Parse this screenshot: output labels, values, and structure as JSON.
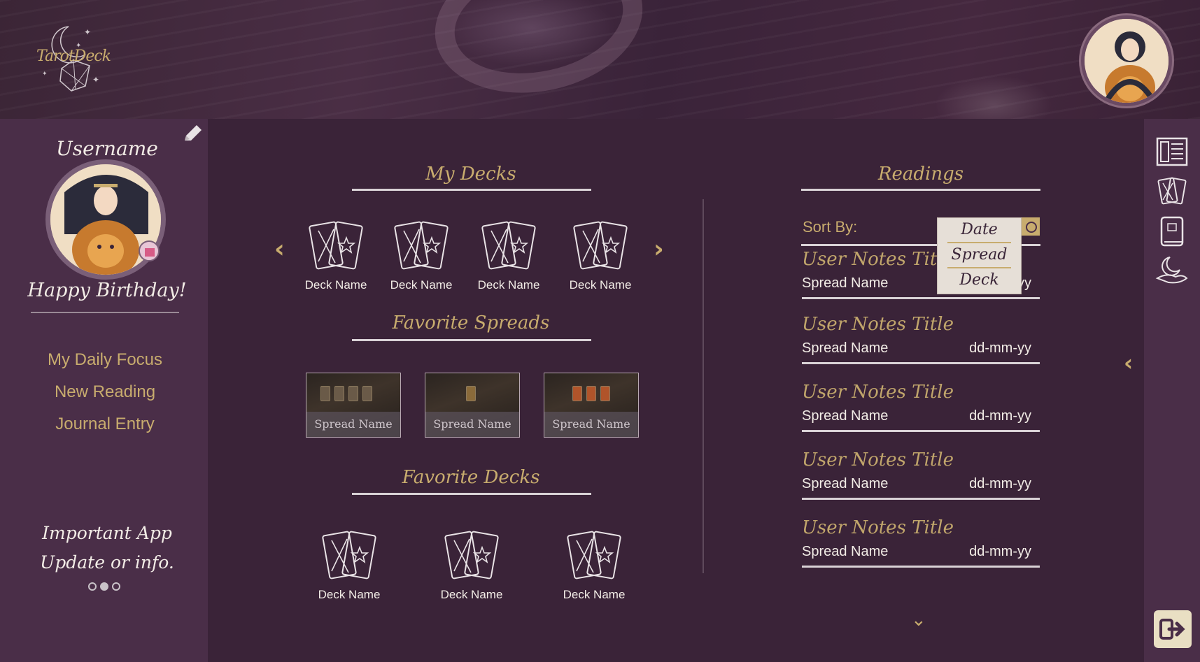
{
  "app": {
    "logo_text": "TarotDeck"
  },
  "profile": {
    "username": "Username",
    "greeting": "Happy Birthday!"
  },
  "left_nav": [
    "My Daily Focus",
    "New Reading",
    "Journal Entry"
  ],
  "info_banner": {
    "line1": "Important App",
    "line2": "Update or info."
  },
  "my_decks": {
    "title": "My Decks",
    "items": [
      "Deck Name",
      "Deck Name",
      "Deck Name",
      "Deck Name"
    ]
  },
  "favorite_spreads": {
    "title": "Favorite Spreads",
    "items": [
      "Spread Name",
      "Spread Name",
      "Spread Name"
    ]
  },
  "favorite_decks": {
    "title": "Favorite Decks",
    "items": [
      "Deck Name",
      "Deck Name",
      "Deck Name"
    ]
  },
  "readings": {
    "title": "Readings",
    "sort_label": "Sort By:",
    "sort_options": [
      "Date",
      "Spread",
      "Deck"
    ],
    "items": [
      {
        "title": "User Notes Title",
        "spread": "Spread Name",
        "date": "dd-mm-yy"
      },
      {
        "title": "User Notes Title",
        "spread": "Spread Name",
        "date": "dd-mm-yy"
      },
      {
        "title": "User Notes Title",
        "spread": "Spread Name",
        "date": "dd-mm-yy"
      },
      {
        "title": "User Notes Title",
        "spread": "Spread Name",
        "date": "dd-mm-yy"
      },
      {
        "title": "User Notes Title",
        "spread": "Spread Name",
        "date": "dd-mm-yy"
      }
    ]
  },
  "icons": {
    "edit": "pencil-icon",
    "right_sidebar": [
      "layout-icon",
      "tarot-cards-icon",
      "journal-book-icon",
      "moon-hand-icon"
    ],
    "logout": "logout-icon"
  },
  "colors": {
    "background": "#3a2338",
    "sidebar": "#4a2e48",
    "accent_gold": "#c8ac6e",
    "text_light": "#f2ece6"
  }
}
